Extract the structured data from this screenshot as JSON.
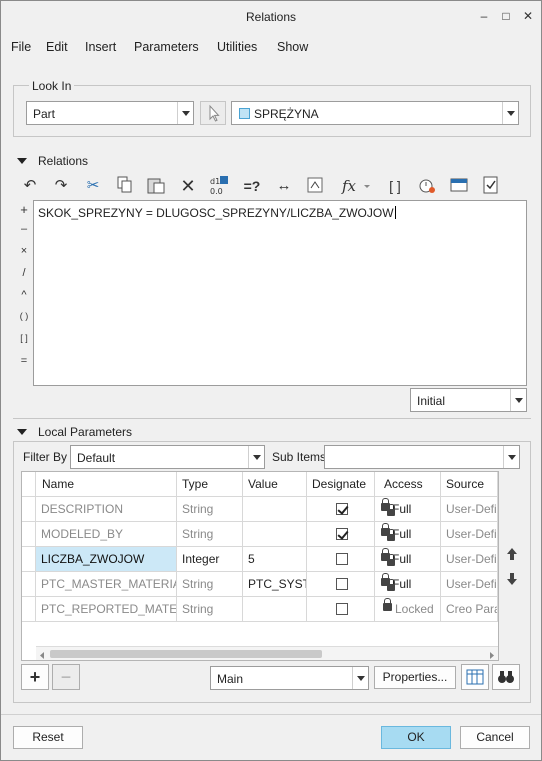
{
  "window": {
    "title": "Relations",
    "minimize_glyph": "–",
    "maximize_glyph": "□",
    "close_glyph": "✕"
  },
  "menu": [
    "File",
    "Edit",
    "Insert",
    "Parameters",
    "Utilities",
    "Show"
  ],
  "look_in": {
    "label": "Look In",
    "type_value": "Part",
    "model_value": "SPRĘŻYNA"
  },
  "relations": {
    "label": "Relations",
    "toolbar_icons": [
      "undo-icon",
      "redo-icon",
      "cut-icon",
      "copy-icon",
      "paste-icon",
      "delete-icon",
      "display-values-icon",
      "evaluate-icon",
      "units-icon",
      "sort-icon",
      "insert-function-icon",
      "brackets-icon",
      "verify-icon",
      "local-params-icon",
      "sort-relations-icon"
    ],
    "operators": [
      "+",
      "–",
      "×",
      "/",
      "^",
      "( )",
      "[ ]",
      "="
    ],
    "text": "SKOK_SPREZYNY = DLUGOSC_SPREZYNY/LICZBA_ZWOJOW",
    "initial_value": "Initial"
  },
  "local_parameters": {
    "label": "Local Parameters",
    "filter_by_label": "Filter By",
    "filter_by_value": "Default",
    "sub_items_label": "Sub Items",
    "sub_items_value": "",
    "columns": [
      "Name",
      "Type",
      "Value",
      "Designate",
      "Access",
      "Source"
    ],
    "rows": [
      {
        "name": "DESCRIPTION",
        "type": "String",
        "value": "",
        "designate": true,
        "access": "Full",
        "source": "User-Defin"
      },
      {
        "name": "MODELED_BY",
        "type": "String",
        "value": "",
        "designate": true,
        "access": "Full",
        "source": "User-Defin"
      },
      {
        "name": "LICZBA_ZWOJOW",
        "type": "Integer",
        "value": "5",
        "designate": false,
        "access": "Full",
        "source": "User-Defin"
      },
      {
        "name": "PTC_MASTER_MATERIAL",
        "type": "String",
        "value": "PTC_SYSTEM",
        "designate": false,
        "access": "Full",
        "source": "User-Defin"
      },
      {
        "name": "PTC_REPORTED_MATERIAL",
        "type": "String",
        "value": "",
        "designate": false,
        "access": "Locked",
        "source": "Creo Param"
      }
    ],
    "add_glyph": "+",
    "remove_glyph": "−",
    "main_value": "Main",
    "properties_label": "Properties..."
  },
  "footer": {
    "reset_label": "Reset",
    "ok_label": "OK",
    "cancel_label": "Cancel"
  },
  "colors": {
    "selected_row": "#cce8f7",
    "ok_button": "#a7dbf2"
  }
}
